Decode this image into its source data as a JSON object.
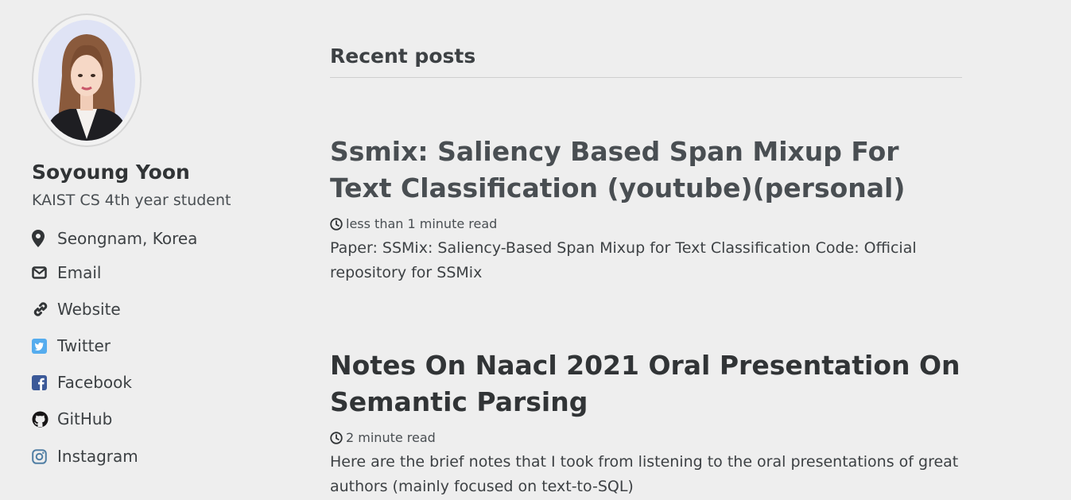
{
  "author": {
    "name": "Soyoung Yoon",
    "bio": "KAIST CS 4th year student",
    "links": [
      {
        "label": "Seongnam, Korea",
        "icon": "location-icon"
      },
      {
        "label": "Email",
        "icon": "envelope-icon"
      },
      {
        "label": "Website",
        "icon": "link-icon"
      },
      {
        "label": "Twitter",
        "icon": "twitter-icon"
      },
      {
        "label": "Facebook",
        "icon": "facebook-icon"
      },
      {
        "label": "GitHub",
        "icon": "github-icon"
      },
      {
        "label": "Instagram",
        "icon": "instagram-icon"
      }
    ]
  },
  "main": {
    "heading": "Recent posts",
    "posts": [
      {
        "title": "Ssmix: Saliency Based Span Mixup For Text Classification (youtube)(personal)",
        "read_time": "less than 1 minute read",
        "excerpt": "Paper: SSMix: Saliency-Based Span Mixup for Text Classification Code: Official repository for SSMix"
      },
      {
        "title": "Notes On Naacl 2021 Oral Presentation On Semantic Parsing",
        "read_time": "2 minute read",
        "excerpt": "Here are the brief notes that I took from listening to the oral presentations of great authors (mainly focused on text-to-SQL)"
      }
    ]
  },
  "colors": {
    "background": "#eeeeee",
    "twitter": "#55acee",
    "facebook": "#3b5998",
    "instagram": "#517fa4"
  }
}
